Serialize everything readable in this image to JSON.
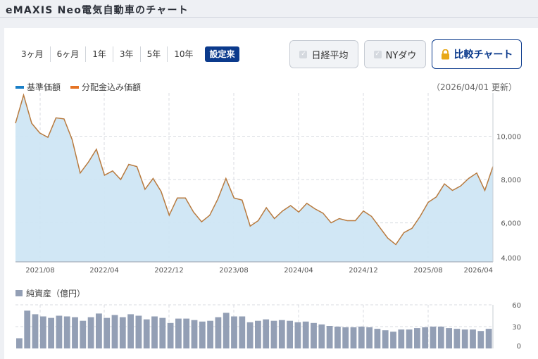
{
  "page": {
    "title": "eMAXIS Neo電気自動車のチャート"
  },
  "periods": [
    {
      "label": "3ヶ月",
      "active": false
    },
    {
      "label": "6ヶ月",
      "active": false
    },
    {
      "label": "1年",
      "active": false
    },
    {
      "label": "3年",
      "active": false
    },
    {
      "label": "5年",
      "active": false
    },
    {
      "label": "10年",
      "active": false
    },
    {
      "label": "設定来",
      "active": true
    }
  ],
  "options": {
    "nikkei_label": "日経平均",
    "nydow_label": "NYダウ",
    "compare_label": "比較チャート"
  },
  "icons": {
    "check": "check-icon",
    "lock": "lock-icon"
  },
  "legend": {
    "nav_label": "基準価額",
    "dist_label": "分配金込み価額",
    "updated": "（2026/04/01 更新）"
  },
  "colors": {
    "nav": "#1a7fc7",
    "dist": "#e57324",
    "area_fill": "#cfe6f4",
    "line": "#b87a3e",
    "bars": "#939fb5",
    "accent": "#0b3a8c"
  },
  "chart_data": [
    {
      "type": "area",
      "x_ticks": [
        "2021/08",
        "2022/04",
        "2022/12",
        "2023/08",
        "2024/04",
        "2024/12",
        "2025/08",
        "2026/04"
      ],
      "y_ticks": [
        "4,000",
        "6,000",
        "8,000",
        "10,000"
      ],
      "ylim": [
        4200,
        12000
      ],
      "series": [
        {
          "name": "基準価額",
          "values": [
            10600,
            11900,
            10600,
            10150,
            9950,
            10850,
            10800,
            9850,
            8300,
            8800,
            9400,
            8200,
            8400,
            8000,
            8700,
            8600,
            7550,
            8050,
            7450,
            6350,
            7150,
            7150,
            6500,
            6050,
            6350,
            7100,
            8050,
            7150,
            7050,
            5850,
            6100,
            6700,
            6200,
            6550,
            6800,
            6500,
            6900,
            6650,
            6450,
            6000,
            6200,
            6100,
            6100,
            6550,
            6300,
            5800,
            5300,
            5000,
            5550,
            5750,
            6300,
            6950,
            7200,
            7800,
            7500,
            7700,
            8050,
            8300,
            7500,
            8600
          ]
        }
      ]
    },
    {
      "type": "bar",
      "title": "純資産（億円）",
      "y_ticks": [
        "0",
        "30",
        "60"
      ],
      "ylim": [
        0,
        60
      ],
      "series": [
        {
          "name": "純資産（億円）",
          "values": [
            14,
            52,
            47,
            44,
            42,
            45,
            44,
            43,
            38,
            43,
            48,
            42,
            46,
            43,
            47,
            45,
            40,
            44,
            42,
            35,
            41,
            41,
            39,
            37,
            38,
            43,
            49,
            44,
            44,
            36,
            38,
            40,
            38,
            39,
            38,
            36,
            37,
            35,
            33,
            31,
            30,
            29,
            29,
            30,
            29,
            27,
            25,
            23,
            26,
            26,
            28,
            29,
            30,
            30,
            28,
            27,
            26,
            26,
            24,
            27
          ]
        }
      ]
    }
  ]
}
